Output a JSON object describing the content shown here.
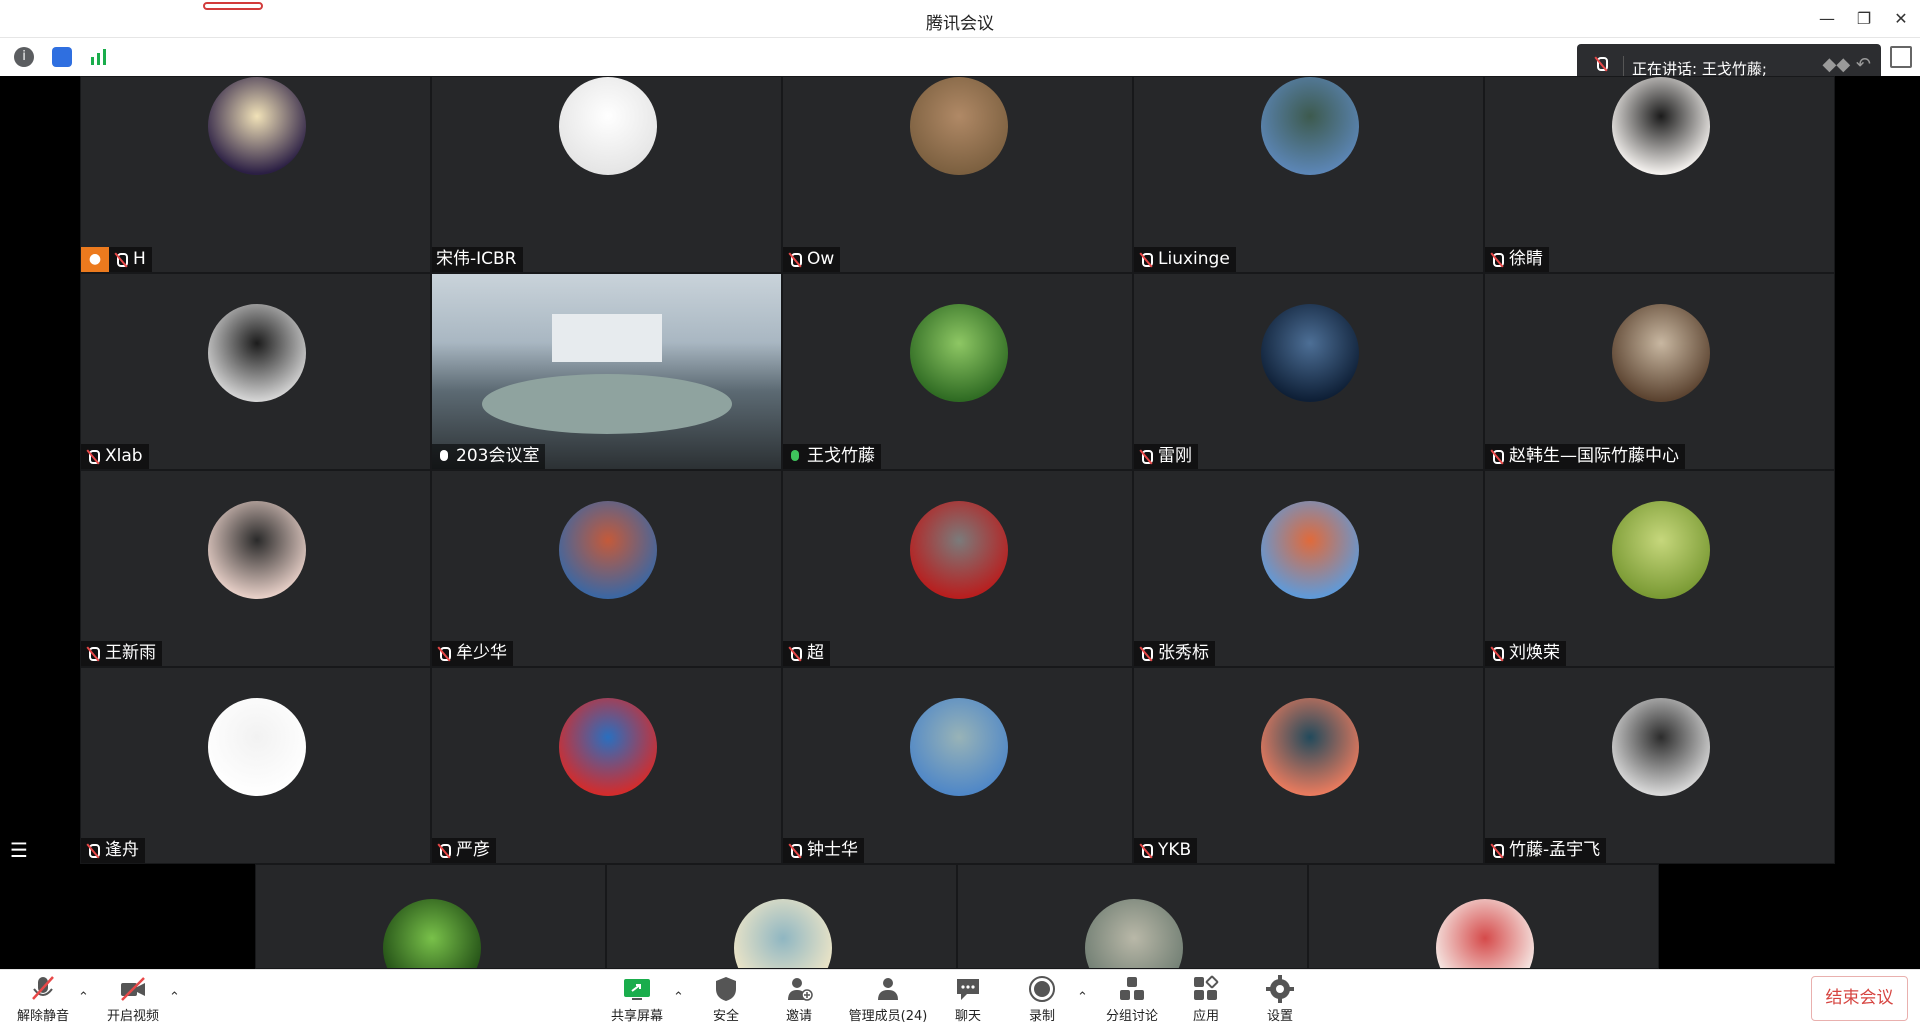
{
  "window": {
    "title": "腾讯会议"
  },
  "speaking": {
    "label": "正在讲话: 王戈竹藤;"
  },
  "participants": [
    {
      "name": "H",
      "host": true,
      "mic": "off",
      "avatar_colors": [
        "#2b1f44",
        "#f1e2b8"
      ]
    },
    {
      "name": "宋伟-ICBR",
      "mic": "none",
      "avatar_colors": [
        "#e5e5e5",
        "#ffffff"
      ]
    },
    {
      "name": "Ow",
      "mic": "off",
      "avatar_colors": [
        "#7c6040",
        "#b08966"
      ]
    },
    {
      "name": "Liuxinge",
      "mic": "off",
      "avatar_colors": [
        "#5c86b6",
        "#3d5a4e"
      ]
    },
    {
      "name": "徐睛",
      "mic": "off",
      "avatar_colors": [
        "#f4f1ee",
        "#1b1b1b"
      ]
    },
    {
      "name": "Xlab",
      "mic": "off",
      "avatar_colors": [
        "#d4d4d4",
        "#1c1c1c"
      ]
    },
    {
      "name": "203会议室",
      "mic": "on",
      "video": true
    },
    {
      "name": "王戈竹藤",
      "mic": "on-green",
      "avatar_colors": [
        "#2f6b23",
        "#8ec764"
      ]
    },
    {
      "name": "雷刚",
      "mic": "off",
      "avatar_colors": [
        "#0e1f36",
        "#4d6f96"
      ]
    },
    {
      "name": "赵韩生—国际竹藤中心",
      "mic": "off",
      "avatar_colors": [
        "#5b4330",
        "#c8b7a1"
      ]
    },
    {
      "name": "王新雨",
      "mic": "off",
      "avatar_colors": [
        "#e7cfc7",
        "#2a2a2a"
      ]
    },
    {
      "name": "牟少华",
      "mic": "off",
      "avatar_colors": [
        "#3b67a3",
        "#c45a3a"
      ]
    },
    {
      "name": "超",
      "mic": "off",
      "avatar_colors": [
        "#b81e1e",
        "#7b7b7b"
      ]
    },
    {
      "name": "张秀标",
      "mic": "off",
      "avatar_colors": [
        "#5f9ad9",
        "#e06a3b"
      ]
    },
    {
      "name": "刘焕荣",
      "mic": "off",
      "avatar_colors": [
        "#7a9a34",
        "#c6d77c"
      ]
    },
    {
      "name": "逢舟",
      "mic": "off",
      "avatar_colors": [
        "#ffffff",
        "#f2f2f2"
      ]
    },
    {
      "name": "严彦",
      "mic": "off",
      "avatar_colors": [
        "#d32c2c",
        "#2a6fbf"
      ]
    },
    {
      "name": "钟士华",
      "mic": "off",
      "avatar_colors": [
        "#4f87c7",
        "#98b3b7"
      ]
    },
    {
      "name": "YKB",
      "mic": "off",
      "avatar_colors": [
        "#e97b5e",
        "#224a5c"
      ]
    },
    {
      "name": "竹藤-孟宇飞",
      "mic": "off",
      "avatar_colors": [
        "#d9d9d9",
        "#2c2c2c"
      ]
    }
  ],
  "bottom_row": [
    {
      "avatar_colors": [
        "#1f4b14",
        "#79c14a"
      ]
    },
    {
      "avatar_colors": [
        "#f1e7c7",
        "#8fb6c2"
      ]
    },
    {
      "avatar_colors": [
        "#6f7d72",
        "#b9b8a8"
      ]
    },
    {
      "avatar_colors": [
        "#f7f0ec",
        "#d54a4a"
      ]
    }
  ],
  "toolbar": {
    "unmute": "解除静音",
    "start_video": "开启视频",
    "share_screen": "共享屏幕",
    "security": "安全",
    "invite": "邀请",
    "manage_members": "管理成员(24)",
    "chat": "聊天",
    "record": "录制",
    "breakout": "分组讨论",
    "apps": "应用",
    "settings": "设置",
    "end_meeting": "结束会议"
  },
  "colors": {
    "accent_green": "#1aad4c",
    "end_red": "#d64541",
    "host_orange": "#ec7a1e"
  }
}
